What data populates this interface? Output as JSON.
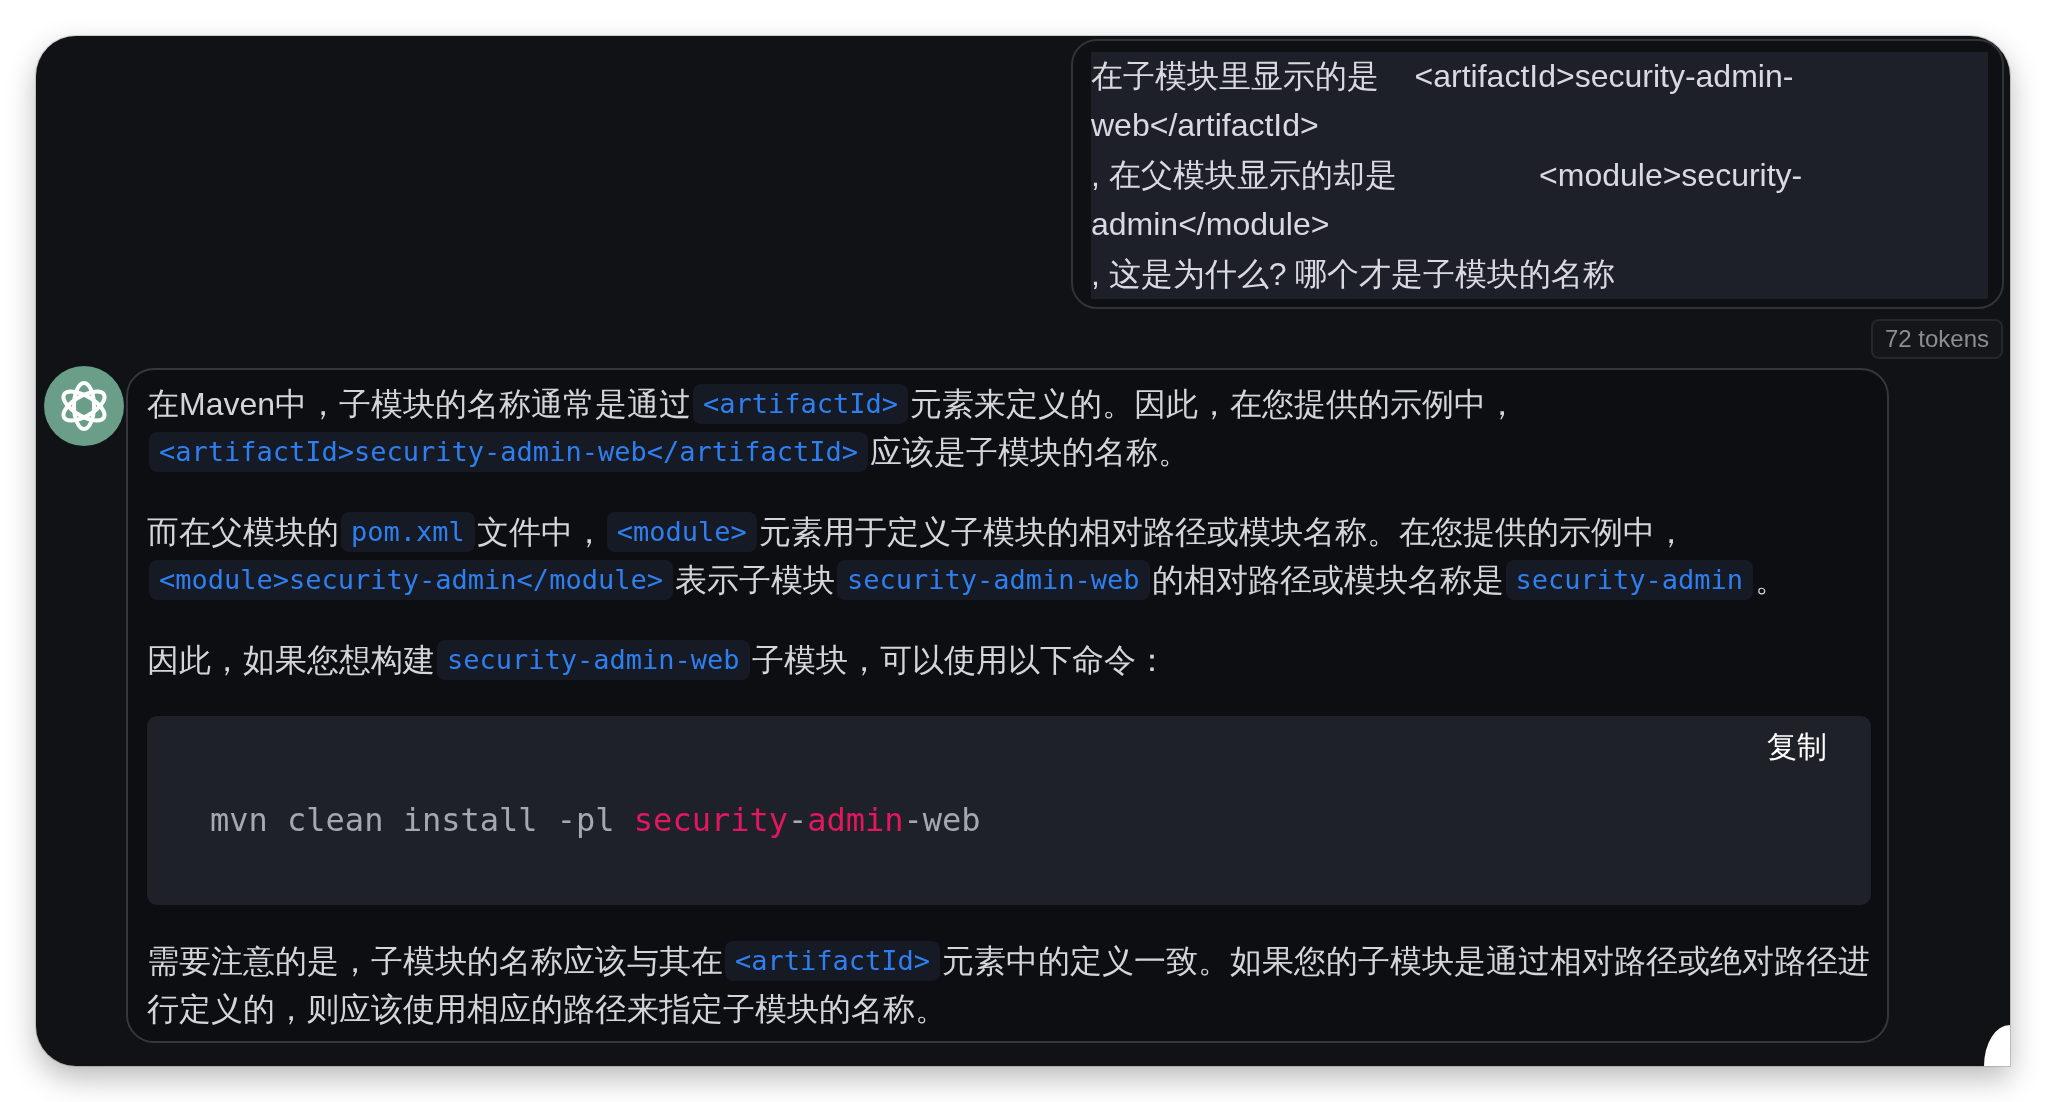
{
  "user_message": {
    "lines": [
      "在子模块里显示的是    <artifactId>security-admin-",
      "web</artifactId>",
      ", 在父模块显示的却是                <module>security-",
      "admin</module>",
      ", 这是为什么? 哪个才是子模块的名称"
    ],
    "token_count": "72 tokens"
  },
  "assistant_message": {
    "blocks": [
      {
        "kind": "paragraph",
        "lines": [
          {
            "parts": [
              {
                "kind": "text",
                "text": "在Maven中，子模块的名称通常是通过"
              },
              {
                "kind": "code",
                "text": "<artifactId>"
              },
              {
                "kind": "text",
                "text": "元素来定义的。因此，在您提供的示例中，"
              }
            ]
          },
          {
            "parts": [
              {
                "kind": "code",
                "text": "<artifactId>security-admin-web</artifactId>"
              },
              {
                "kind": "text",
                "text": "应该是子模块的名称。"
              }
            ]
          }
        ]
      },
      {
        "kind": "paragraph",
        "lines": [
          {
            "parts": [
              {
                "kind": "text",
                "text": "而在父模块的"
              },
              {
                "kind": "code",
                "text": "pom.xml"
              },
              {
                "kind": "text",
                "text": "文件中，"
              },
              {
                "kind": "code",
                "text": "<module>"
              },
              {
                "kind": "text",
                "text": "元素用于定义子模块的相对路径或模块名称。在您提供的示例中，"
              }
            ]
          },
          {
            "parts": [
              {
                "kind": "code",
                "text": "<module>security-admin</module>"
              },
              {
                "kind": "text",
                "text": "表示子模块"
              },
              {
                "kind": "code",
                "text": "security-admin-web"
              },
              {
                "kind": "text",
                "text": "的相对路径或模块名称是"
              },
              {
                "kind": "code",
                "text": "security-admin"
              },
              {
                "kind": "text",
                "text": "。"
              }
            ]
          }
        ]
      },
      {
        "kind": "paragraph",
        "lines": [
          {
            "parts": [
              {
                "kind": "text",
                "text": "因此，如果您想构建"
              },
              {
                "kind": "code",
                "text": "security-admin-web"
              },
              {
                "kind": "text",
                "text": "子模块，可以使用以下命令："
              }
            ]
          }
        ]
      },
      {
        "kind": "code_block",
        "copy_label": "复制",
        "tokens": [
          {
            "kind": "plain",
            "text": "mvn clean install -pl "
          },
          {
            "kind": "keyword",
            "text": "security"
          },
          {
            "kind": "plain",
            "text": "-"
          },
          {
            "kind": "keyword",
            "text": "admin"
          },
          {
            "kind": "plain",
            "text": "-web"
          }
        ]
      },
      {
        "kind": "paragraph",
        "lines": [
          {
            "parts": [
              {
                "kind": "text",
                "text": "需要注意的是，子模块的名称应该与其在"
              },
              {
                "kind": "code",
                "text": "<artifactId>"
              },
              {
                "kind": "text",
                "text": "元素中的定义一致。如果您的子模块是通过相对路径或绝对路径进"
              }
            ]
          },
          {
            "parts": [
              {
                "kind": "text",
                "text": "行定义的，则应该使用相应的路径来指定子模块的名称。"
              }
            ]
          }
        ]
      }
    ]
  }
}
